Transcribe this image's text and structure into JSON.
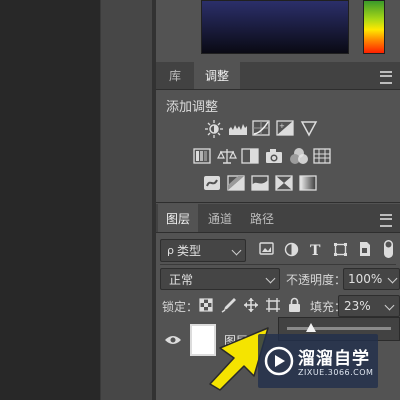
{
  "adjustments_panel": {
    "tabs": [
      {
        "label": "库",
        "active": false
      },
      {
        "label": "调整",
        "active": true
      }
    ],
    "title": "添加调整",
    "icons_row1": [
      "brightness-contrast-icon",
      "levels-icon",
      "curves-icon",
      "exposure-icon",
      "vibrance-icon"
    ],
    "icons_row2": [
      "hue-saturation-icon",
      "color-balance-icon",
      "black-white-icon",
      "photo-filter-icon",
      "channel-mixer-icon",
      "color-lookup-icon"
    ],
    "icons_row3": [
      "invert-icon",
      "posterize-icon",
      "threshold-icon",
      "selective-color-icon",
      "gradient-map-icon"
    ]
  },
  "layers_panel": {
    "tabs": [
      {
        "label": "图层",
        "active": true
      },
      {
        "label": "通道",
        "active": false
      },
      {
        "label": "路径",
        "active": false
      }
    ],
    "filter_kind": "类型",
    "filter_prefix": "ρ",
    "blend_mode": "正常",
    "opacity_label": "不透明度：",
    "opacity_value": "100%",
    "lock_label": "锁定：",
    "fill_label": "填充：",
    "fill_value": "23%",
    "fill_slider_value": 0.23,
    "layer_name": "图层"
  },
  "watermark": {
    "name": "溜溜自学",
    "url": "ZIXUE.3066.COM"
  },
  "colors": {
    "panel_bg": "#535353",
    "tab_bg": "#424242",
    "canvas_bg": "#282828",
    "annotation_arrow": "#f5e400"
  }
}
